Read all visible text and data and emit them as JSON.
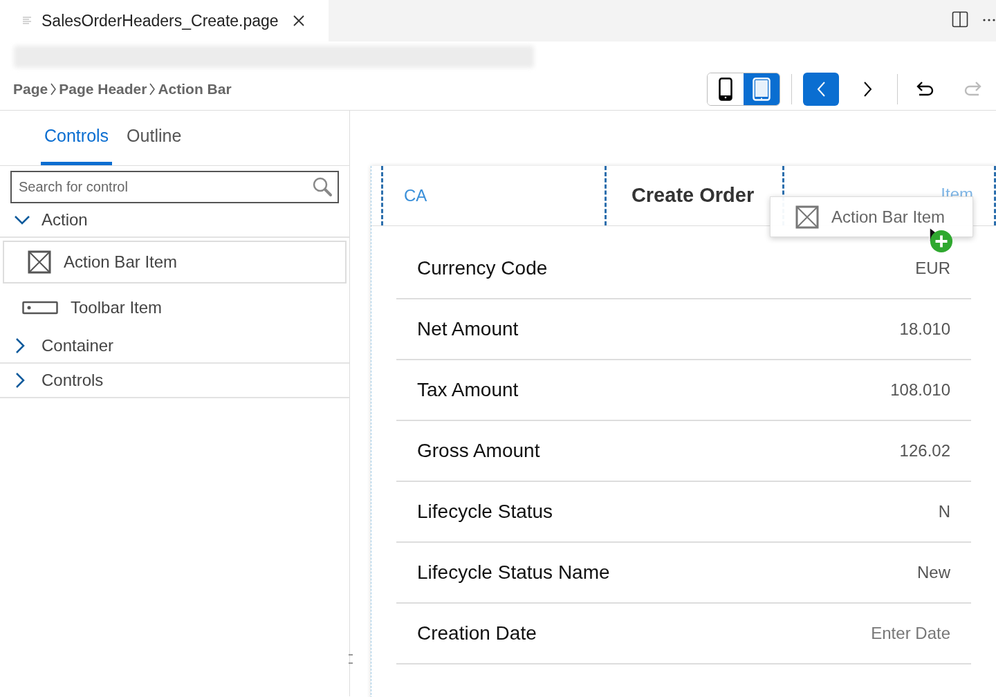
{
  "editor_tab": {
    "title": "SalesOrderHeaders_Create.page"
  },
  "breadcrumb": [
    "Page",
    "Page Header",
    "Action Bar"
  ],
  "toolbar": {
    "devices": [
      {
        "kind": "phone",
        "selected": false
      },
      {
        "kind": "tablet",
        "selected": true
      }
    ],
    "back": {
      "disabled": false
    },
    "forward": {
      "disabled": false
    },
    "undo": {
      "disabled": false
    },
    "redo": {
      "disabled": true
    }
  },
  "panel_tabs": [
    {
      "label": "Controls",
      "selected": true
    },
    {
      "label": "Outline",
      "selected": false
    }
  ],
  "search": {
    "placeholder": "Search for control"
  },
  "tree": [
    {
      "label": "Action",
      "expanded": true,
      "children": [
        {
          "label": "Action Bar Item",
          "kind": "action-bar-item",
          "selected": true
        },
        {
          "label": "Toolbar Item",
          "kind": "toolbar-item",
          "selected": false
        }
      ]
    },
    {
      "label": "Container",
      "expanded": false
    },
    {
      "label": "Controls",
      "expanded": false
    }
  ],
  "preview": {
    "left_action": "CA",
    "title": "Create Order",
    "right_action": "Item",
    "rows": [
      {
        "label": "Currency Code",
        "value": "EUR",
        "placeholder": false
      },
      {
        "label": "Net Amount",
        "value": "18.010",
        "placeholder": false
      },
      {
        "label": "Tax Amount",
        "value": "108.010",
        "placeholder": false
      },
      {
        "label": "Gross Amount",
        "value": "126.02",
        "placeholder": false
      },
      {
        "label": "Lifecycle Status",
        "value": "N",
        "placeholder": false
      },
      {
        "label": "Lifecycle Status Name",
        "value": "New",
        "placeholder": false
      },
      {
        "label": "Creation Date",
        "value": "Enter Date",
        "placeholder": true
      }
    ]
  },
  "drag_ghost": {
    "label": "Action Bar Item"
  }
}
